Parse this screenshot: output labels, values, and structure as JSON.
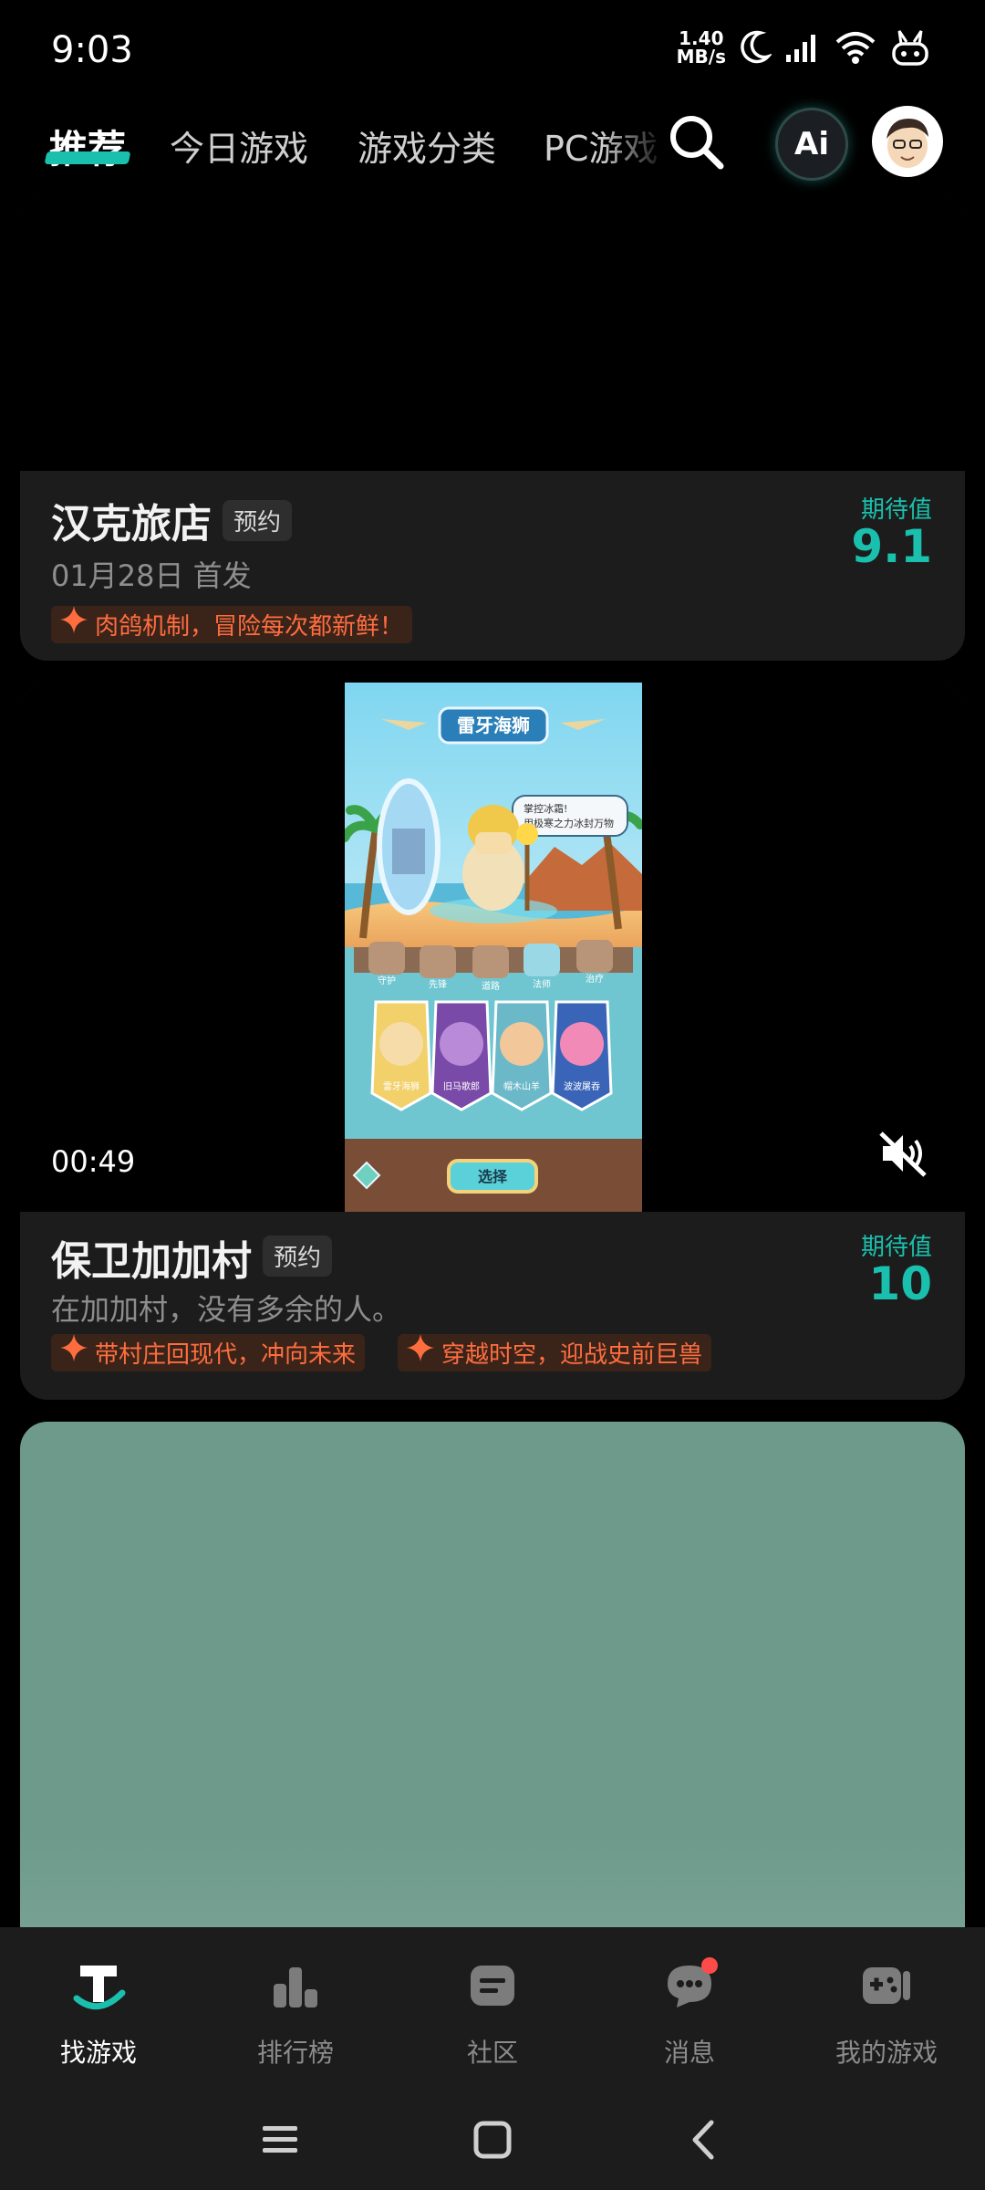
{
  "status_bar": {
    "time": "9:03",
    "net_speed_value": "1.40",
    "net_speed_unit": "MB/s",
    "icons": [
      "moon-icon",
      "signal-icon",
      "wifi-icon",
      "bunny-icon"
    ]
  },
  "top_nav": {
    "tabs": [
      {
        "label": "推荐",
        "active": true
      },
      {
        "label": "今日游戏",
        "active": false
      },
      {
        "label": "游戏分类",
        "active": false
      },
      {
        "label": "PC游戏",
        "active": false
      }
    ],
    "ai_label": "Ai"
  },
  "games": [
    {
      "title": "汉克旅店",
      "badge": "预约",
      "subtitle": "01月28日 首发",
      "tags": [
        "肉鸽机制，冒险每次都新鲜！"
      ],
      "expectation_label": "期待值",
      "expectation_value": "9.1"
    },
    {
      "title": "保卫加加村",
      "badge": "预约",
      "subtitle": "在加加村，没有多余的人。",
      "tags": [
        "带村庄回现代，冲向未来",
        "穿越时空，迎战史前巨兽"
      ],
      "expectation_label": "期待值",
      "expectation_value": "10",
      "video_duration": "00:49",
      "screenshot": {
        "title": "雷牙海狮",
        "speech": [
          "掌控冰霜!",
          "用极寒之力冰封万物"
        ],
        "skills": [
          "守护",
          "先锋",
          "道路",
          "法师",
          "治疗"
        ],
        "characters": [
          "雷牙海狮",
          "旧马歌郎",
          "帽木山羊",
          "波波屠吞"
        ],
        "select_button": "选择"
      }
    }
  ],
  "bottom_nav": {
    "items": [
      {
        "label": "找游戏",
        "icon": "find-game-icon",
        "active": true
      },
      {
        "label": "排行榜",
        "icon": "ranking-icon",
        "active": false
      },
      {
        "label": "社区",
        "icon": "community-icon",
        "active": false
      },
      {
        "label": "消息",
        "icon": "message-icon",
        "active": false,
        "has_dot": true
      },
      {
        "label": "我的游戏",
        "icon": "my-games-icon",
        "active": false
      }
    ]
  },
  "colors": {
    "accent": "#1ac0ad",
    "tag_text": "#ff6d3f",
    "card_bg": "#1c1c1c",
    "placeholder_card": "#6e9a8b"
  }
}
